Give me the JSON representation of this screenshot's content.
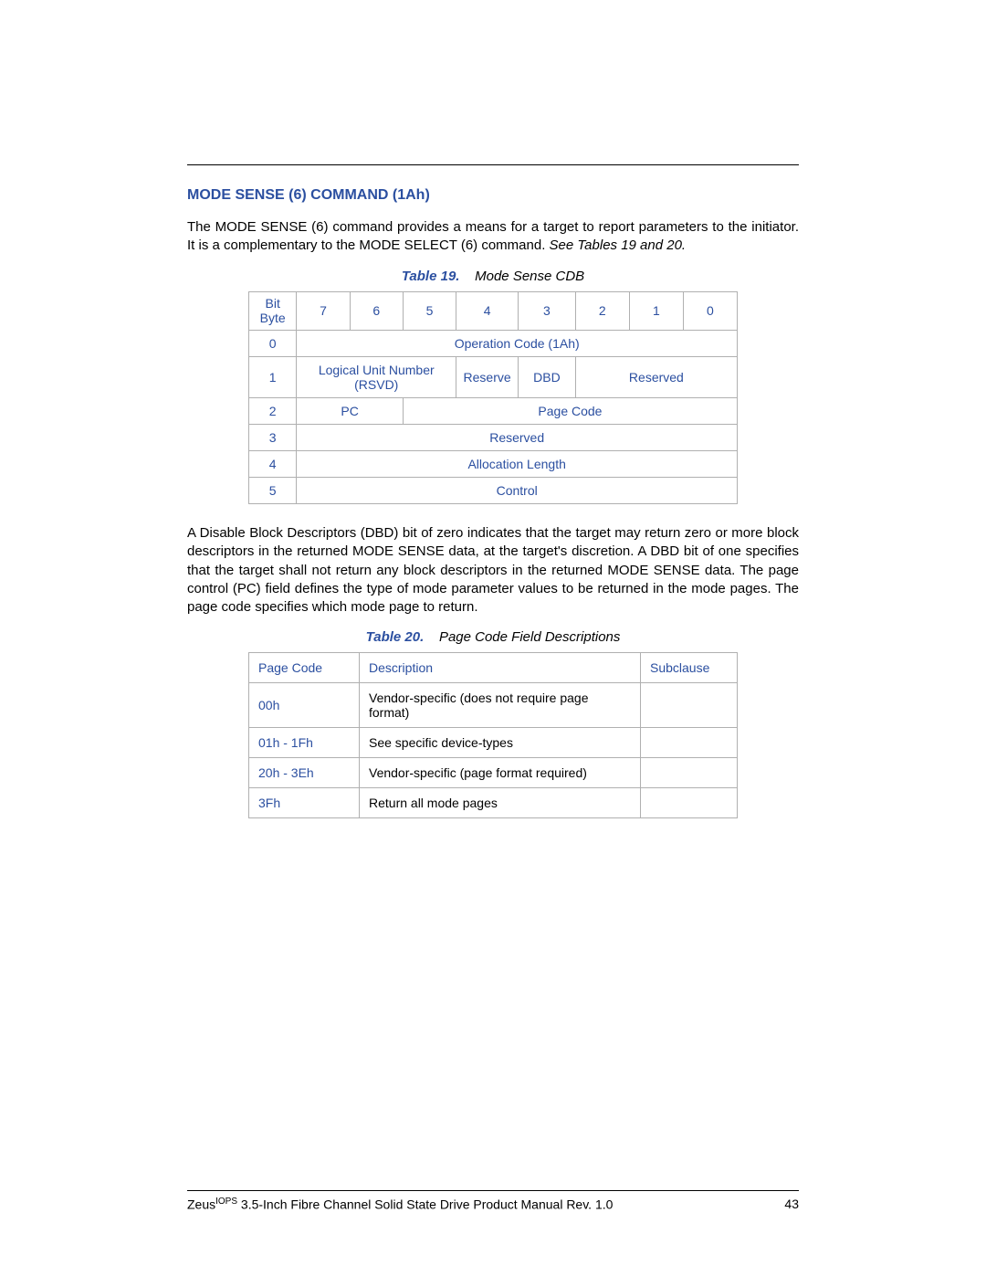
{
  "heading": "MODE SENSE (6) COMMAND (1Ah)",
  "para1_a": "The MODE SENSE (6) command provides a means for a target to report parameters to the initiator. It is a complementary to the MODE SELECT (6) command. ",
  "para1_b": "See Tables 19 and 20.",
  "table19": {
    "label": "Table 19.",
    "title": "Mode Sense CDB",
    "corner_top": "Bit",
    "corner_bot": "Byte",
    "bits": [
      "7",
      "6",
      "5",
      "4",
      "3",
      "2",
      "1",
      "0"
    ],
    "rows": {
      "r0": "0",
      "r1": "1",
      "r2": "2",
      "r3": "3",
      "r4": "4",
      "r5": "5"
    },
    "opcode": "Operation Code (1Ah)",
    "lun": "Logical Unit Number (RSVD)",
    "reserve": "Reserve",
    "dbd": "DBD",
    "reserved": "Reserved",
    "pc": "PC",
    "pagecode": "Page Code",
    "reserved2": "Reserved",
    "alloc": "Allocation Length",
    "control": "Control"
  },
  "para2": "A Disable Block Descriptors (DBD) bit of zero indicates that the target may return zero or more block descriptors in the returned MODE SENSE data, at the target's discretion. A DBD bit of one specifies that the target shall not return any block descriptors in the returned MODE SENSE data. The page control (PC) field defines the type of mode parameter values to be returned in the mode pages. The page code specifies which mode page to return.",
  "table20": {
    "label": "Table 20.",
    "title": "Page Code Field Descriptions",
    "h_code": "Page Code",
    "h_desc": "Description",
    "h_sub": "Subclause",
    "rows": [
      {
        "code": "00h",
        "desc": "Vendor-specific (does not require page format)",
        "sub": ""
      },
      {
        "code": "01h - 1Fh",
        "desc": "See specific device-types",
        "sub": ""
      },
      {
        "code": "20h - 3Eh",
        "desc": "Vendor-specific (page format required)",
        "sub": ""
      },
      {
        "code": "3Fh",
        "desc": "Return all mode pages",
        "sub": ""
      }
    ]
  },
  "footer": {
    "product_pre": "Zeus",
    "product_sup": "IOPS",
    "product_post": " 3.5-Inch Fibre Channel Solid State Drive Product Manual Rev. 1.0",
    "page": "43"
  }
}
